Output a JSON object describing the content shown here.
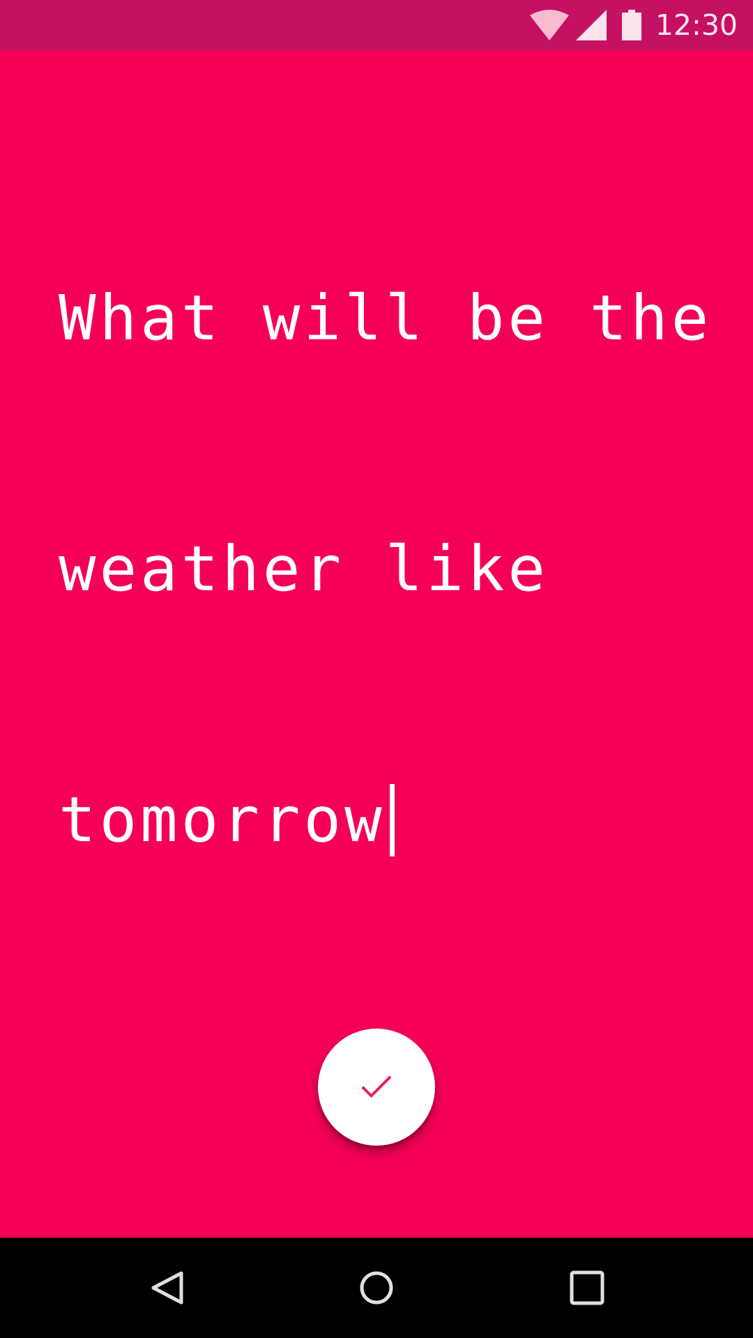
{
  "status_bar": {
    "time": "12:30",
    "icons": [
      "wifi-icon",
      "signal-icon",
      "battery-icon"
    ]
  },
  "editor": {
    "lines": [
      "What will be the",
      "weather like",
      "tomorrow"
    ],
    "text": "What will be the weather like tomorrow"
  },
  "fab": {
    "icon": "check-icon"
  },
  "navigation": {
    "icons": [
      "back-icon",
      "home-icon",
      "recents-icon"
    ]
  },
  "colors": {
    "background": "#f50057",
    "status_bar": "#c51162",
    "accent": "#e91e63",
    "text": "#ffffff",
    "nav_bar": "#000000"
  }
}
